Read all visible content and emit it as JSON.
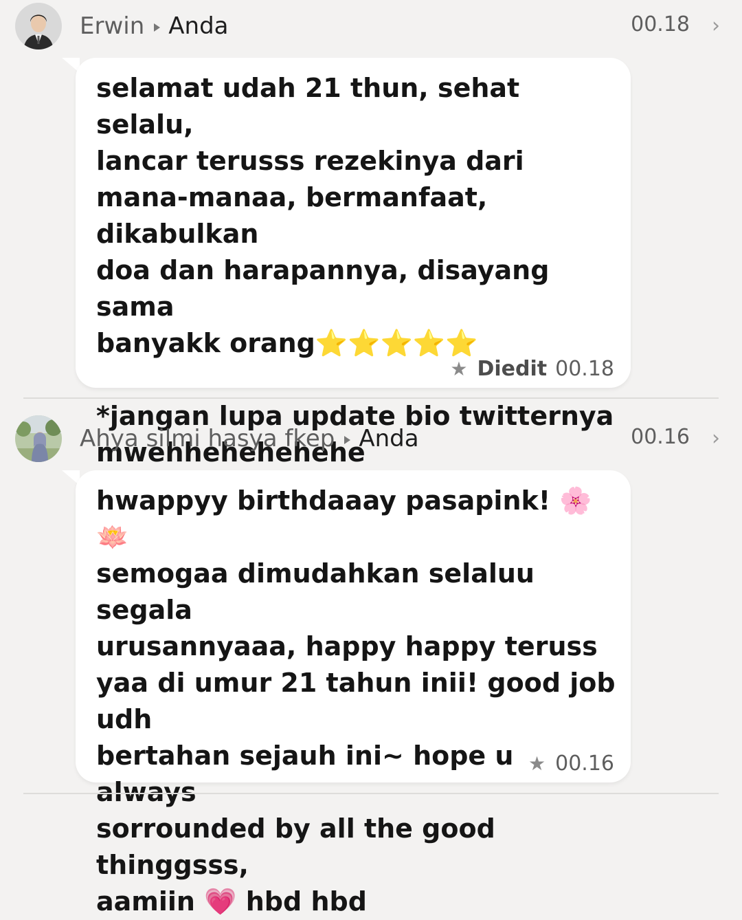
{
  "messages": [
    {
      "sender": "Erwin",
      "recipient": "Anda",
      "time": "00.18",
      "body": "selamat udah 21 thun, sehat selalu,\nlancar terusss rezekinya dari\nmana-manaa, bermanfaat, dikabulkan\ndoa dan harapannya, disayang sama\nbanyakk orang⭐⭐⭐⭐⭐\n\n*jangan lupa update bio twitternya\nmwehhehehehehe",
      "edited_label": "Diedit",
      "footer_time": "00.18",
      "starred": true
    },
    {
      "sender": "Ahya silmi hasya fkep",
      "recipient": "Anda",
      "time": "00.16",
      "body": "hwappyy birthdaaay pasapink! 🌸🪷\nsemogaa dimudahkan selaluu segala\nurusannyaaa, happy happy teruss\nyaa di umur 21 tahun inii! good job udh\nbertahan sejauh ini~ hope u always\nsorrounded by all the good thinggsss,\naamiin 💗 hbd hbd",
      "footer_time": "00.16",
      "starred": true
    }
  ],
  "icons": {
    "star": "★",
    "chevron": "›"
  },
  "colors": {
    "background": "#f3f2f1",
    "bubble": "#ffffff",
    "secondary_text": "#5e5e5e"
  }
}
